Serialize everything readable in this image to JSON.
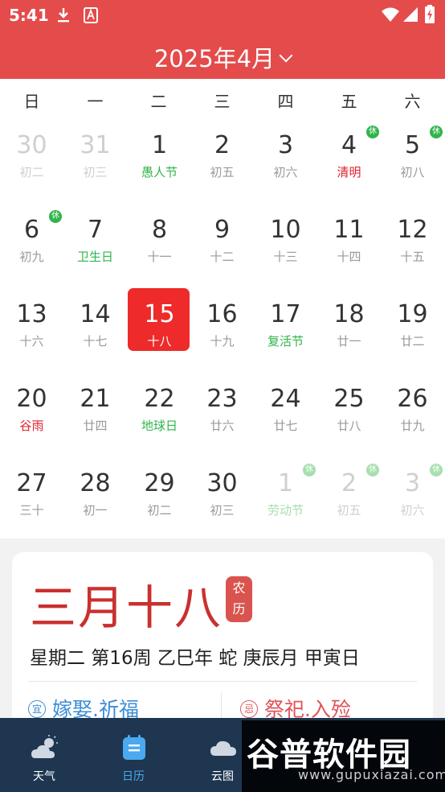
{
  "status_bar": {
    "time": "5:41"
  },
  "header": {
    "month_title": "2025年4月"
  },
  "weekdays": [
    "日",
    "一",
    "二",
    "三",
    "四",
    "五",
    "六"
  ],
  "rows": [
    [
      {
        "num": "30",
        "sub": "初二",
        "dim": true
      },
      {
        "num": "31",
        "sub": "初三",
        "dim": true
      },
      {
        "num": "1",
        "sub": "愚人节",
        "color": "green"
      },
      {
        "num": "2",
        "sub": "初五"
      },
      {
        "num": "3",
        "sub": "初六"
      },
      {
        "num": "4",
        "sub": "清明",
        "color": "red",
        "badge": "休"
      },
      {
        "num": "5",
        "sub": "初八",
        "badge": "休"
      }
    ],
    [
      {
        "num": "6",
        "sub": "初九",
        "badge": "休"
      },
      {
        "num": "7",
        "sub": "卫生日",
        "color": "green"
      },
      {
        "num": "8",
        "sub": "十一"
      },
      {
        "num": "9",
        "sub": "十二"
      },
      {
        "num": "10",
        "sub": "十三"
      },
      {
        "num": "11",
        "sub": "十四"
      },
      {
        "num": "12",
        "sub": "十五"
      }
    ],
    [
      {
        "num": "13",
        "sub": "十六"
      },
      {
        "num": "14",
        "sub": "十七"
      },
      {
        "num": "15",
        "sub": "十八",
        "selected": true
      },
      {
        "num": "16",
        "sub": "十九"
      },
      {
        "num": "17",
        "sub": "复活节",
        "color": "green"
      },
      {
        "num": "18",
        "sub": "廿一"
      },
      {
        "num": "19",
        "sub": "廿二"
      }
    ],
    [
      {
        "num": "20",
        "sub": "谷雨",
        "color": "red"
      },
      {
        "num": "21",
        "sub": "廿四"
      },
      {
        "num": "22",
        "sub": "地球日",
        "color": "green"
      },
      {
        "num": "23",
        "sub": "廿六"
      },
      {
        "num": "24",
        "sub": "廿七"
      },
      {
        "num": "25",
        "sub": "廿八"
      },
      {
        "num": "26",
        "sub": "廿九"
      }
    ],
    [
      {
        "num": "27",
        "sub": "三十"
      },
      {
        "num": "28",
        "sub": "初一"
      },
      {
        "num": "29",
        "sub": "初二"
      },
      {
        "num": "30",
        "sub": "初三"
      },
      {
        "num": "1",
        "sub": "劳动节",
        "color": "green",
        "dim": true,
        "badge": "休"
      },
      {
        "num": "2",
        "sub": "初五",
        "dim": true,
        "badge": "休"
      },
      {
        "num": "3",
        "sub": "初六",
        "dim": true,
        "badge": "休"
      }
    ]
  ],
  "card": {
    "lunar_date": "三月十八",
    "lunar_tag": [
      "农",
      "历"
    ],
    "info_line": "星期二 第16周 乙巳年 蛇 庚辰月 甲寅日",
    "yi_icon": "宜",
    "yi_text": "嫁娶.祈福",
    "ji_icon": "忌",
    "ji_text": "祭祀.入殓"
  },
  "nav": [
    {
      "label": "天气",
      "icon": "weather-icon",
      "active": false
    },
    {
      "label": "日历",
      "icon": "calendar-icon",
      "active": true
    },
    {
      "label": "云图",
      "icon": "cloud-icon",
      "active": false
    }
  ],
  "watermark": {
    "title": "谷普软件园",
    "url": "www.gupuxiazai.com"
  },
  "colors": {
    "header": "#e44b4b",
    "selected": "#ee2a2a",
    "green": "#2fb54a",
    "red": "#e0202e",
    "nav_bg": "#1e3650",
    "nav_active": "#4aa9f0"
  }
}
